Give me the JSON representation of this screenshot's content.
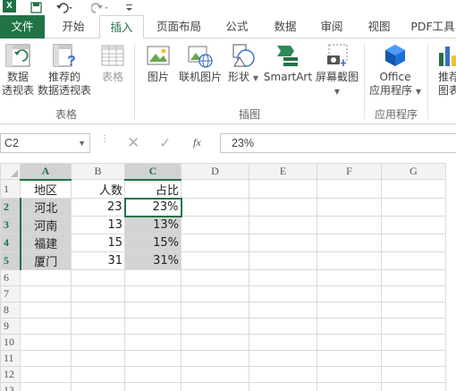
{
  "title_bar": {
    "logo": "X",
    "icons": [
      "save-icon",
      "undo-icon",
      "redo-icon",
      "customize-qat-icon"
    ]
  },
  "tabs": [
    {
      "label": "文件",
      "kind": "file"
    },
    {
      "label": "开始"
    },
    {
      "label": "插入",
      "active": true
    },
    {
      "label": "页面布局"
    },
    {
      "label": "公式"
    },
    {
      "label": "数据"
    },
    {
      "label": "审阅"
    },
    {
      "label": "视图"
    },
    {
      "label": "PDF工具"
    }
  ],
  "ribbon": {
    "tables_group": {
      "label": "表格",
      "pivot_line1": "数据",
      "pivot_line2": "透视表",
      "recommended_line1": "推荐的",
      "recommended_line2": "数据透视表",
      "table": "表格"
    },
    "illustrations_group": {
      "label": "插图",
      "picture": "图片",
      "online_picture": "联机图片",
      "shapes": "形状",
      "smartart": "SmartArt",
      "screenshot": "屏幕截图"
    },
    "apps_group": {
      "label": "应用程序",
      "office_line1": "Office",
      "office_line2": "应用程序"
    },
    "recommended_charts_line1": "推荐",
    "recommended_charts_line2": "图表"
  },
  "formula_bar": {
    "name_box": "C2",
    "value": "23%",
    "fx": "fx"
  },
  "columns": [
    "A",
    "B",
    "C",
    "D",
    "E",
    "F",
    "G"
  ],
  "rows": [
    {
      "num": "1",
      "a": "地区",
      "b": "人数",
      "c": "占比"
    },
    {
      "num": "2",
      "a": "河北",
      "b": "23",
      "c": "23%"
    },
    {
      "num": "3",
      "a": "河南",
      "b": "13",
      "c": "13%"
    },
    {
      "num": "4",
      "a": "福建",
      "b": "15",
      "c": "15%"
    },
    {
      "num": "5",
      "a": "厦门",
      "b": "31",
      "c": "31%"
    },
    {
      "num": "6"
    },
    {
      "num": "7"
    },
    {
      "num": "8"
    },
    {
      "num": "9"
    },
    {
      "num": "10"
    },
    {
      "num": "11"
    },
    {
      "num": "12"
    },
    {
      "num": "13"
    }
  ],
  "colors": {
    "accent": "#217346",
    "selection": "#d4d4d4"
  }
}
